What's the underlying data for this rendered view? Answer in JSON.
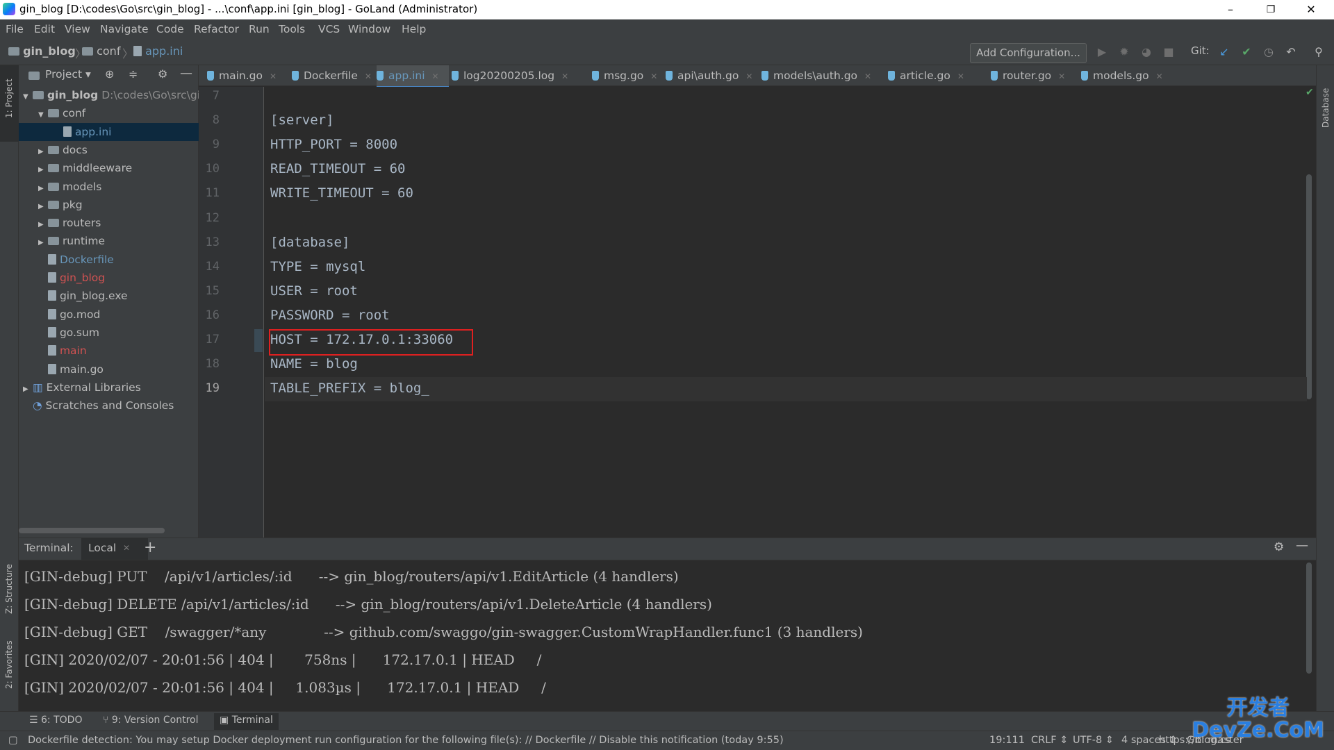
{
  "window": {
    "title": "gin_blog [D:\\codes\\Go\\src\\gin_blog] - ...\\conf\\app.ini [gin_blog] - GoLand (Administrator)",
    "minimize": "–",
    "restore": "❐",
    "close": "✕"
  },
  "menu": [
    "File",
    "Edit",
    "View",
    "Navigate",
    "Code",
    "Refactor",
    "Run",
    "Tools",
    "VCS",
    "Window",
    "Help"
  ],
  "breadcrumb": [
    "gin_blog",
    "conf",
    "app.ini"
  ],
  "toolbar": {
    "add_configuration": "Add Configuration...",
    "git_label": "Git:"
  },
  "left_strip": {
    "project": "1: Project",
    "structure": "Z: Structure",
    "favorites": "2: Favorites"
  },
  "right_strip": {
    "database": "Database"
  },
  "project_panel": {
    "title": "Project",
    "root_name": "gin_blog",
    "root_path": "D:\\codes\\Go\\src\\gi",
    "items": [
      {
        "label": "conf",
        "kind": "folder",
        "depth": 1,
        "expanded": true
      },
      {
        "label": "app.ini",
        "kind": "file",
        "depth": 2,
        "selected": true,
        "color": "#6897bb"
      },
      {
        "label": "docs",
        "kind": "folder",
        "depth": 1
      },
      {
        "label": "middleeware",
        "kind": "folder",
        "depth": 1
      },
      {
        "label": "models",
        "kind": "folder",
        "depth": 1
      },
      {
        "label": "pkg",
        "kind": "folder",
        "depth": 1
      },
      {
        "label": "routers",
        "kind": "folder",
        "depth": 1
      },
      {
        "label": "runtime",
        "kind": "folder",
        "depth": 1
      },
      {
        "label": "Dockerfile",
        "kind": "file",
        "depth": 1,
        "color": "#6897bb"
      },
      {
        "label": "gin_blog",
        "kind": "file",
        "depth": 1,
        "color": "#d25252"
      },
      {
        "label": "gin_blog.exe",
        "kind": "file",
        "depth": 1
      },
      {
        "label": "go.mod",
        "kind": "file",
        "depth": 1
      },
      {
        "label": "go.sum",
        "kind": "file",
        "depth": 1
      },
      {
        "label": "main",
        "kind": "file",
        "depth": 1,
        "color": "#d25252"
      },
      {
        "label": "main.go",
        "kind": "file",
        "depth": 1
      }
    ],
    "external_libraries": "External Libraries",
    "scratches": "Scratches and Consoles"
  },
  "tabs": [
    {
      "label": "main.go"
    },
    {
      "label": "Dockerfile"
    },
    {
      "label": "app.ini",
      "active": true
    },
    {
      "label": "log20200205.log"
    },
    {
      "label": "msg.go"
    },
    {
      "label": "api\\auth.go"
    },
    {
      "label": "models\\auth.go"
    },
    {
      "label": "article.go"
    },
    {
      "label": "router.go"
    },
    {
      "label": "models.go"
    }
  ],
  "editor": {
    "lines": [
      {
        "n": "7",
        "text": ""
      },
      {
        "n": "8",
        "text": "[server]"
      },
      {
        "n": "9",
        "text": "HTTP_PORT = 8000"
      },
      {
        "n": "10",
        "text": "READ_TIMEOUT = 60"
      },
      {
        "n": "11",
        "text": "WRITE_TIMEOUT = 60"
      },
      {
        "n": "12",
        "text": ""
      },
      {
        "n": "13",
        "text": "[database]"
      },
      {
        "n": "14",
        "text": "TYPE = mysql"
      },
      {
        "n": "15",
        "text": "USER = root"
      },
      {
        "n": "16",
        "text": "PASSWORD = root"
      },
      {
        "n": "17",
        "text": "HOST = 172.17.0.1:33060"
      },
      {
        "n": "18",
        "text": "NAME = blog"
      },
      {
        "n": "19",
        "text": "TABLE_PREFIX = blog_"
      }
    ]
  },
  "terminal": {
    "label": "Terminal:",
    "tab": "Local",
    "add": "+",
    "lines": [
      "[GIN-debug] PUT    /api/v1/articles/:id      --> gin_blog/routers/api/v1.EditArticle (4 handlers)",
      "[GIN-debug] DELETE /api/v1/articles/:id      --> gin_blog/routers/api/v1.DeleteArticle (4 handlers)",
      "[GIN-debug] GET    /swagger/*any             --> github.com/swaggo/gin-swagger.CustomWrapHandler.func1 (3 handlers)",
      "[GIN] 2020/02/07 - 20:01:56 | 404 |       758ns |      172.17.0.1 | HEAD     /",
      "[GIN] 2020/02/07 - 20:01:56 | 404 |     1.083µs |      172.17.0.1 | HEAD     /"
    ]
  },
  "tool_windows": [
    "6: TODO",
    "9: Version Control",
    "Terminal"
  ],
  "status": {
    "message": "Dockerfile detection: You may setup Docker deployment run configuration for the following file(s): // Dockerfile // Disable this notification (today 9:55)",
    "position": "19:111",
    "line_sep": "CRLF ⇕",
    "encoding": "UTF-8 ⇕",
    "indent": "4 spaces ⇕",
    "url": "https://blog.cs",
    "git": "Git: master"
  },
  "watermark": {
    "top": "开发者",
    "bottom": "DevZe.CoM"
  }
}
